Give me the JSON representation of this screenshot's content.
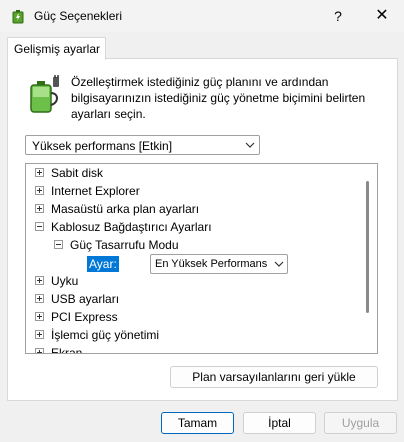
{
  "window": {
    "title": "Güç Seçenekleri",
    "help_glyph": "?",
    "close_glyph": "✕"
  },
  "tab": {
    "label": "Gelişmiş ayarlar"
  },
  "description": "Özelleştirmek istediğiniz güç planını ve ardından bilgisayarınızın istediğiniz güç yönetme biçimini belirten ayarları seçin.",
  "plan_select": {
    "value": "Yüksek performans [Etkin]"
  },
  "tree": {
    "items": [
      {
        "label": "Sabit disk",
        "expander": "+"
      },
      {
        "label": "Internet Explorer",
        "expander": "+"
      },
      {
        "label": "Masaüstü arka plan ayarları",
        "expander": "+"
      },
      {
        "label": "Kablosuz Bağdaştırıcı Ayarları",
        "expander": "−"
      },
      {
        "label": "Güç Tasarrufu Modu",
        "expander": "−"
      },
      {
        "label": "Uyku",
        "expander": "+"
      },
      {
        "label": "USB ayarları",
        "expander": "+"
      },
      {
        "label": "PCI Express",
        "expander": "+"
      },
      {
        "label": "İşlemci güç yönetimi",
        "expander": "+"
      },
      {
        "label": "Ekran",
        "expander": "+"
      }
    ],
    "setting": {
      "label": "Ayar:",
      "value": "En Yüksek Performans"
    }
  },
  "buttons": {
    "restore": "Plan varsayılanlarını geri yükle",
    "ok": "Tamam",
    "cancel": "İptal",
    "apply": "Uygula"
  },
  "icons": {
    "app": "power-options-icon",
    "battery": "battery-plug-icon"
  },
  "colors": {
    "selection": "#0078d7",
    "ok_border": "#0067c0"
  }
}
